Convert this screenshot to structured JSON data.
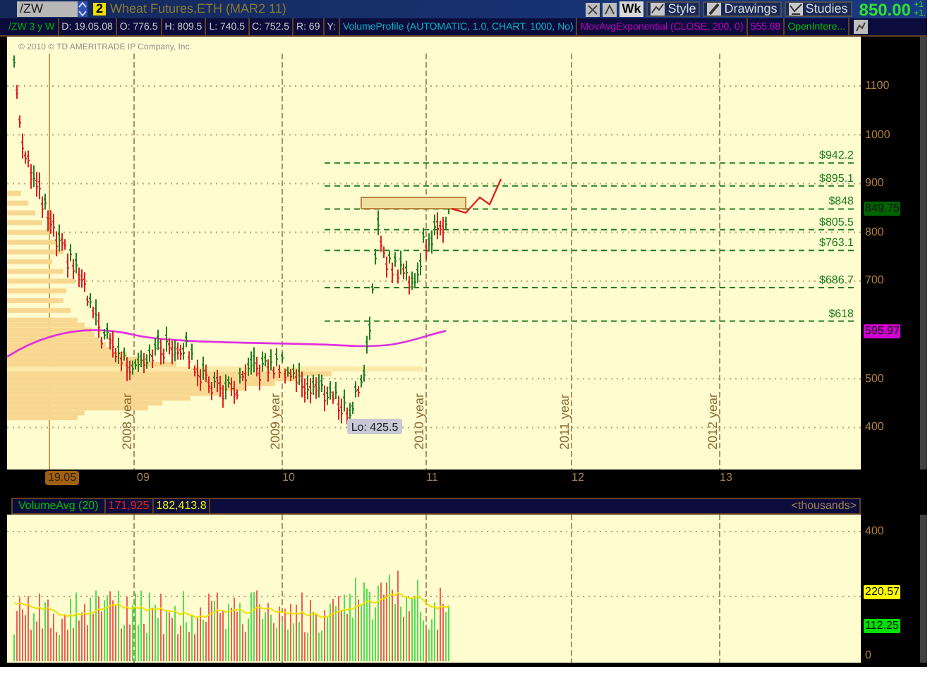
{
  "toolbar": {
    "symbol": "/ZW",
    "link_group": "2",
    "description": "Wheat Futures,ETH (MAR2 11)",
    "buttons": [
      {
        "label": "Wk",
        "kind": "plain"
      },
      {
        "label": "Style",
        "kind": "style"
      },
      {
        "label": "Drawings",
        "kind": "pencil"
      },
      {
        "label": "Studies",
        "kind": "studies"
      }
    ],
    "last_price": "850.00",
    "change": [
      "+1",
      "+1."
    ]
  },
  "header": {
    "title": "/ZW 3 y W",
    "fields": [
      "D: 19.05.08",
      "O: 776.5",
      "H: 809.5",
      "L: 740.5",
      "C: 752.5",
      "R: 69",
      "Y:"
    ],
    "studies": [
      {
        "label": "VolumeProfile (AUTOMATIC, 1.0, CHART, 1000, No)",
        "kind": "profile"
      },
      {
        "label": "MovAvgExponential (CLOSE, 200, 0)",
        "kind": "average"
      },
      {
        "label": "555.68",
        "kind": "average"
      },
      {
        "label": "OpenIntere...",
        "kind": "interest"
      }
    ]
  },
  "price_chart": {
    "copyright": "© 2010 © TD AMERITRADE IP Company, Inc.",
    "y_axis": [
      "1100",
      "1000",
      "900",
      "800",
      "700",
      "500",
      "400"
    ],
    "year_labels": [
      "2008 year",
      "2009 year",
      "2010 year",
      "2011 year",
      "2012 year"
    ],
    "levels": [
      "$942.2",
      "$895.1",
      "$848",
      "$805.5",
      "$763.1",
      "$686.7",
      "$618"
    ],
    "low_label": "Lo: 425.5",
    "badges": [
      {
        "label": "849.75",
        "color": "#006400"
      },
      {
        "label": "595.97",
        "color": "#d000d0"
      }
    ]
  },
  "time_axis": {
    "cursor": "19.05",
    "labels": [
      "09",
      "10",
      "11",
      "12",
      "13"
    ]
  },
  "volume": {
    "title": "VolumeAvg (20)",
    "value": "171,925",
    "average": "182,413.8",
    "units": "<thousands>",
    "y_axis": [
      "400",
      "0"
    ],
    "badges": [
      {
        "label": "220.57",
        "color": "#ffff00"
      },
      {
        "label": "112.25",
        "color": "#00e000"
      }
    ]
  }
}
